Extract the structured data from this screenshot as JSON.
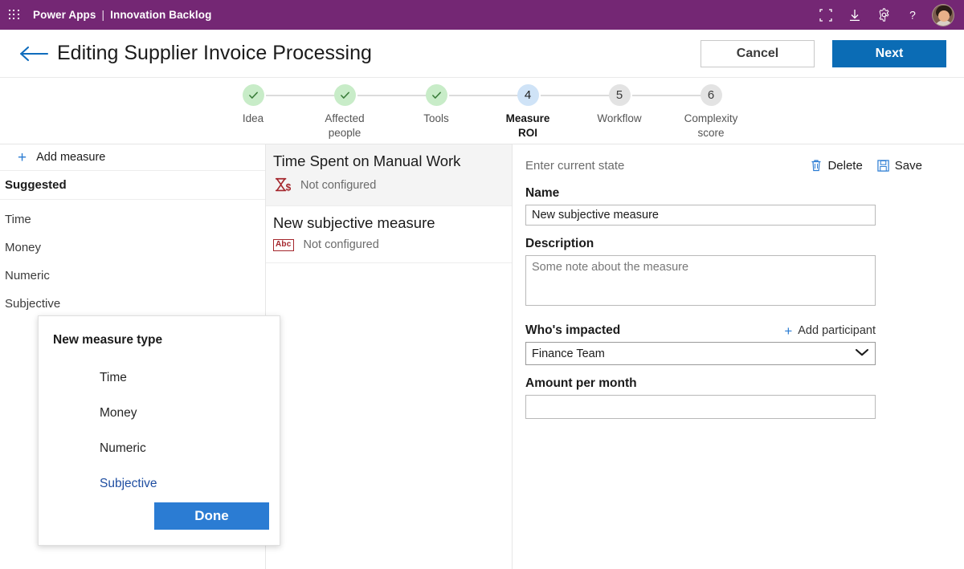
{
  "topbar": {
    "waffle_icon": "waffle-grid-icon",
    "product": "Power Apps",
    "separator": "|",
    "app_name": "Innovation Backlog",
    "icons": [
      "frame-icon",
      "download-icon",
      "gear-icon",
      "help-icon"
    ],
    "avatar": "user-avatar",
    "bg_color": "#742774"
  },
  "titlebar": {
    "back_icon": "back-arrow-icon",
    "title": "Editing Supplier Invoice Processing",
    "cancel_label": "Cancel",
    "next_label": "Next",
    "next_color": "#0b6cb5"
  },
  "stepper": {
    "steps": [
      {
        "num": "1",
        "label": "Idea",
        "state": "done"
      },
      {
        "num": "2",
        "label": "Affected\npeople",
        "label_line1": "Affected",
        "label_line2": "people",
        "state": "done"
      },
      {
        "num": "3",
        "label": "Tools",
        "state": "done"
      },
      {
        "num": "4",
        "label": "Measure ROI",
        "label_line1": "Measure",
        "label_line2": "ROI",
        "state": "active"
      },
      {
        "num": "5",
        "label": "Workflow",
        "state": "pending"
      },
      {
        "num": "6",
        "label": "Complexity score",
        "label_line1": "Complexity",
        "label_line2": "score",
        "state": "pending"
      }
    ],
    "done_color": "#c8ecc8",
    "active_color": "#cfe3f7",
    "pending_color": "#e3e3e3"
  },
  "left_pane": {
    "add_measure_label": "Add measure",
    "add_measure_icon": "plus-icon",
    "suggested_header": "Suggested",
    "items": [
      {
        "label": "Time"
      },
      {
        "label": "Money"
      },
      {
        "label": "Numeric"
      },
      {
        "label": "Subjective"
      }
    ]
  },
  "middle_pane": {
    "cards": [
      {
        "title": "Time Spent on Manual Work",
        "status": "Not configured",
        "icon": "hourglass-money-icon",
        "selected": true
      },
      {
        "title": "New subjective measure",
        "status": "Not configured",
        "icon": "abc-icon",
        "selected": false
      }
    ]
  },
  "right_pane": {
    "state_text": "Enter current state",
    "delete_label": "Delete",
    "delete_icon": "trash-icon",
    "save_label": "Save",
    "save_icon": "save-disk-icon",
    "name_label": "Name",
    "name_value": "New subjective measure",
    "description_label": "Description",
    "description_value": "",
    "description_placeholder": "Some note about the measure",
    "impacted_label": "Who's impacted",
    "add_participant_label": "Add participant",
    "add_participant_icon": "plus-icon",
    "participant_value": "Finance Team",
    "dropdown_icon": "chevron-down-icon",
    "amount_label": "Amount per month",
    "amount_value": ""
  },
  "modal": {
    "title": "New measure type",
    "options": [
      {
        "label": "Time",
        "selected": false
      },
      {
        "label": "Money",
        "selected": false
      },
      {
        "label": "Numeric",
        "selected": false
      },
      {
        "label": "Subjective",
        "selected": true
      }
    ],
    "done_label": "Done",
    "done_color": "#2b7cd3"
  }
}
